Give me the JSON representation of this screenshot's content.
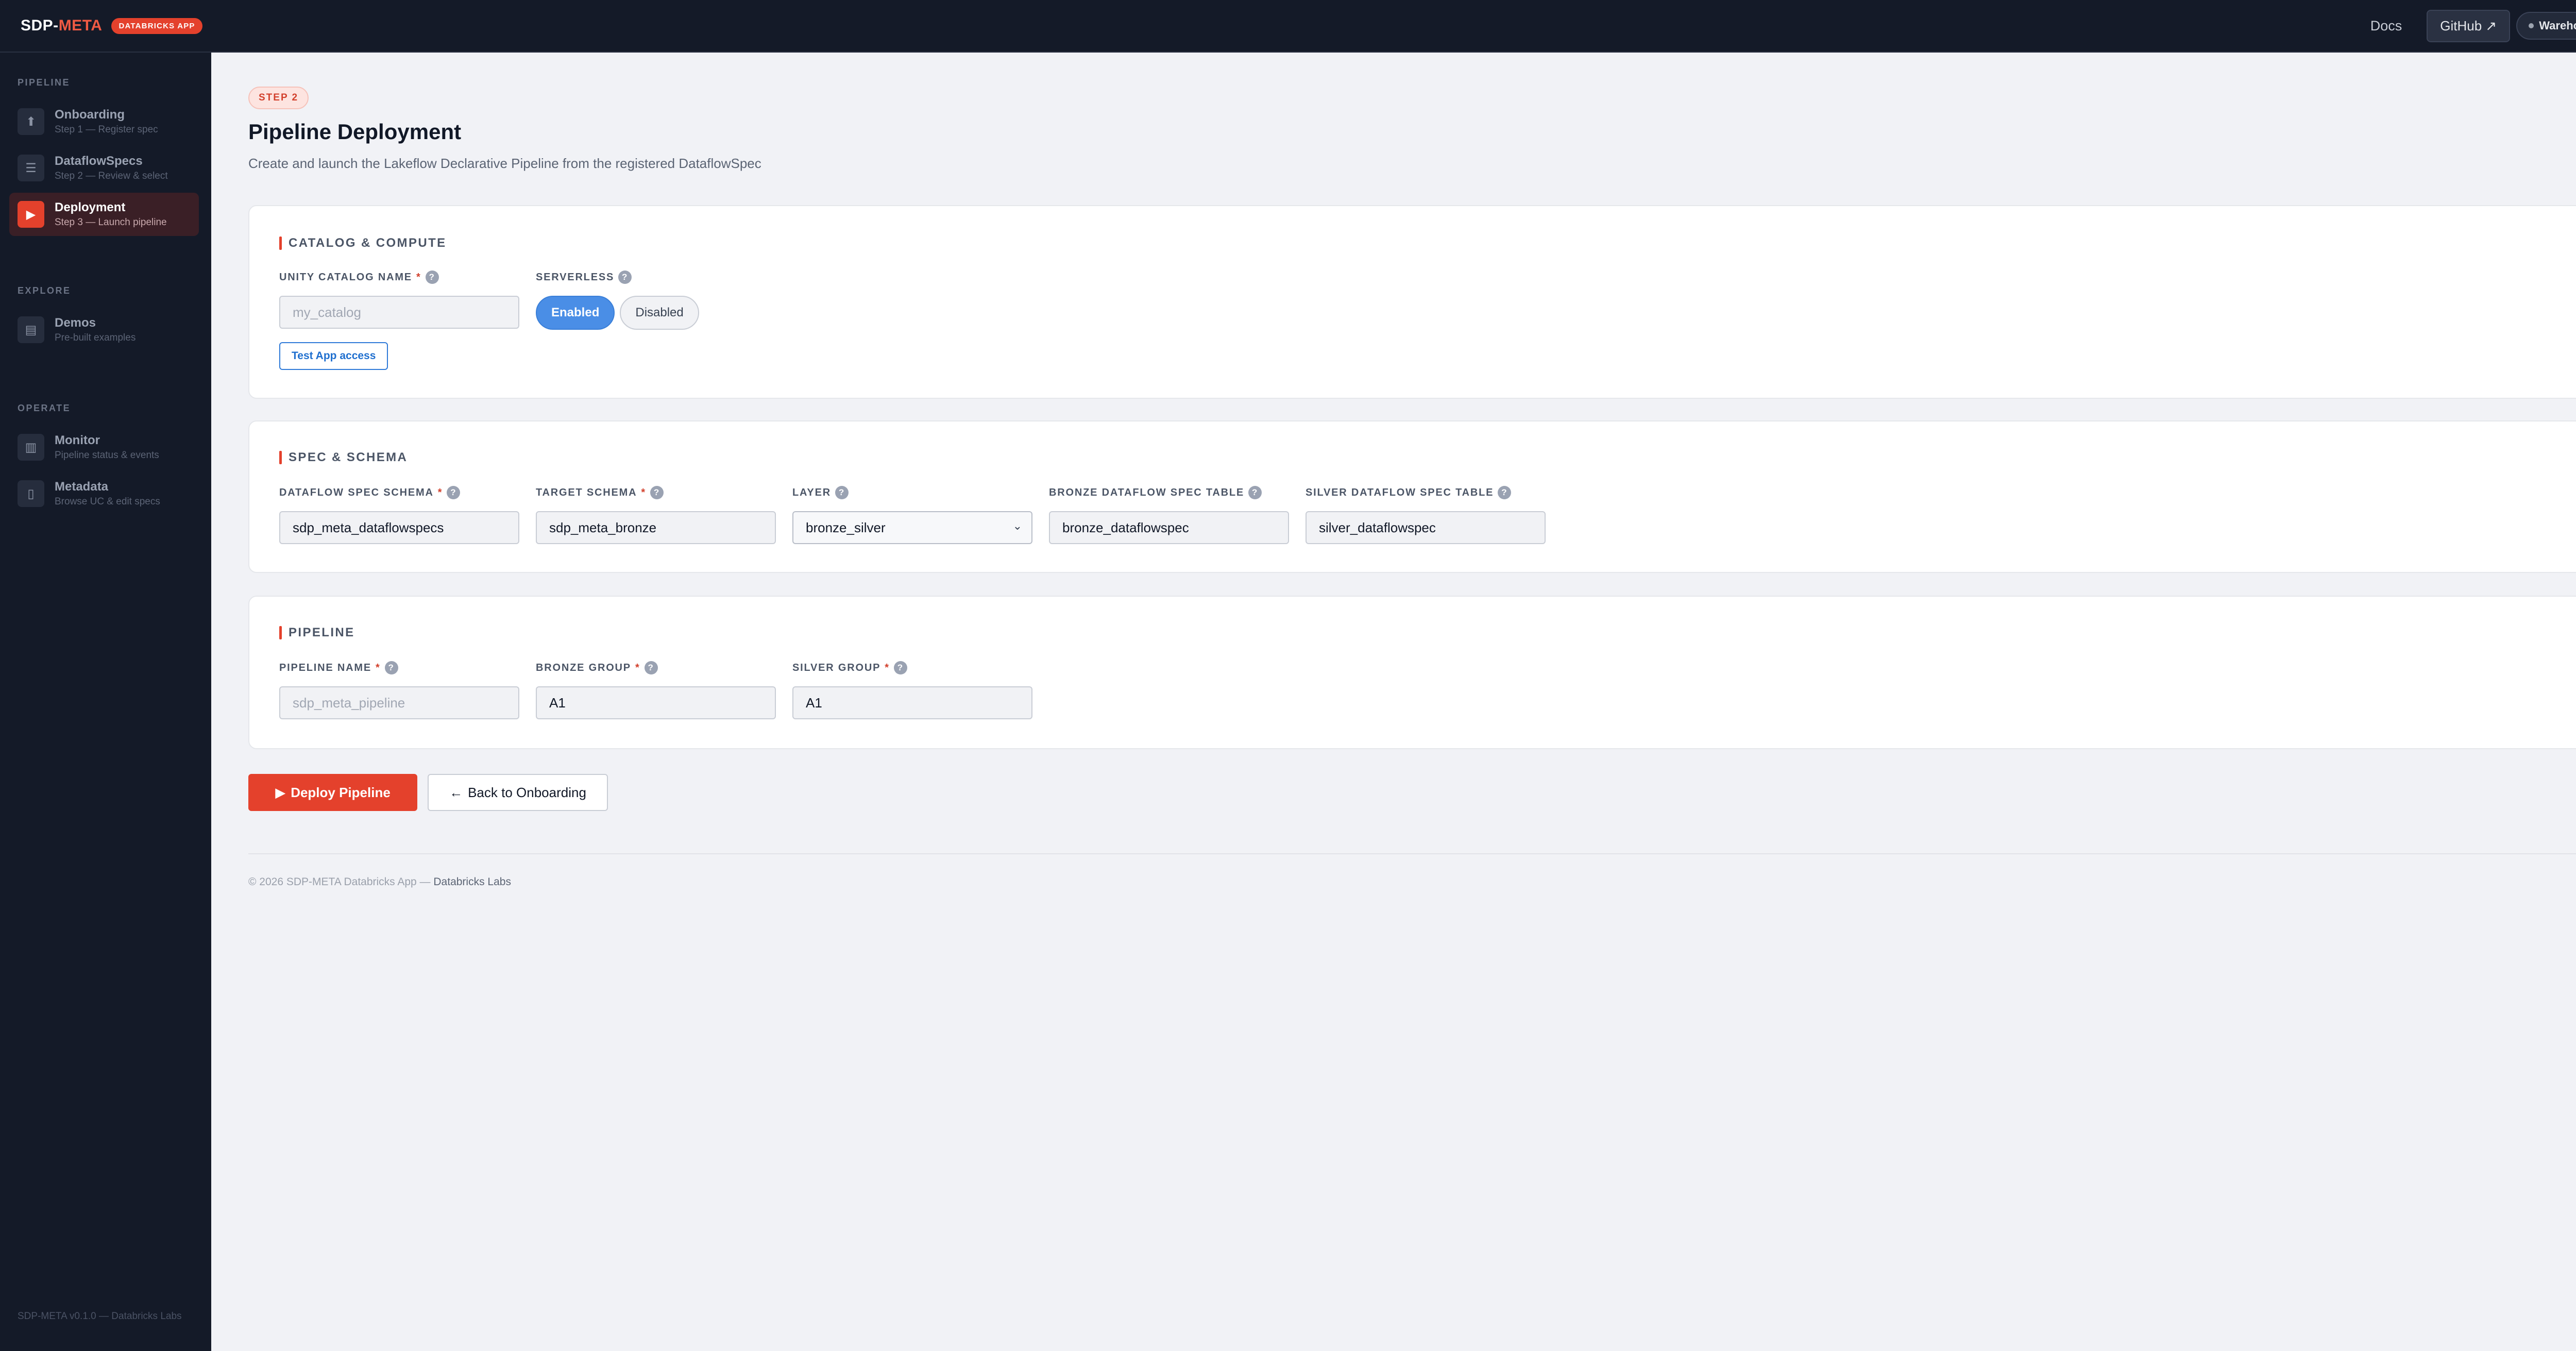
{
  "topbar": {
    "brand_prefix": "SDP-",
    "brand_accent": "META",
    "badge": "DATABRICKS APP",
    "docs": "Docs",
    "github": "GitHub ↗",
    "warehouse": "Warehouse"
  },
  "sidebar": {
    "sections": [
      {
        "label": "PIPELINE",
        "items": [
          {
            "title": "Onboarding",
            "sub": "Step 1 — Register spec",
            "icon": "upload-icon",
            "glyph": "⬆",
            "active": false
          },
          {
            "title": "DataflowSpecs",
            "sub": "Step 2 — Review & select",
            "icon": "list-icon",
            "glyph": "☰",
            "active": false
          },
          {
            "title": "Deployment",
            "sub": "Step 3 — Launch pipeline",
            "icon": "play-icon",
            "glyph": "▶",
            "active": true
          }
        ]
      },
      {
        "label": "EXPLORE",
        "items": [
          {
            "title": "Demos",
            "sub": "Pre-built examples",
            "icon": "demo-icon",
            "glyph": "▤",
            "active": false
          }
        ]
      },
      {
        "label": "OPERATE",
        "items": [
          {
            "title": "Monitor",
            "sub": "Pipeline status & events",
            "icon": "chart-icon",
            "glyph": "▥",
            "active": false
          },
          {
            "title": "Metadata",
            "sub": "Browse UC & edit specs",
            "icon": "document-icon",
            "glyph": "▯",
            "active": false
          }
        ]
      }
    ],
    "footer": "SDP-META v0.1.0 — Databricks Labs"
  },
  "main": {
    "step_badge": "STEP 2",
    "title": "Pipeline Deployment",
    "subtitle": "Create and launch the Lakeflow Declarative Pipeline from the registered DataflowSpec",
    "catalog": {
      "title": "CATALOG & COMPUTE",
      "uc_label": "UNITY CATALOG NAME",
      "uc_placeholder": "my_catalog",
      "serverless_label": "SERVERLESS",
      "enabled": "Enabled",
      "disabled": "Disabled",
      "test_button": "Test App access"
    },
    "spec": {
      "title": "SPEC & SCHEMA",
      "fields": [
        {
          "label": "DATAFLOW SPEC SCHEMA",
          "required": true,
          "value": "sdp_meta_dataflowspecs",
          "type": "input"
        },
        {
          "label": "TARGET SCHEMA",
          "required": true,
          "value": "sdp_meta_bronze",
          "type": "input"
        },
        {
          "label": "LAYER",
          "required": false,
          "value": "bronze_silver",
          "type": "select"
        },
        {
          "label": "BRONZE DATAFLOW SPEC TABLE",
          "required": false,
          "value": "bronze_dataflowspec",
          "type": "input"
        },
        {
          "label": "SILVER DATAFLOW SPEC TABLE",
          "required": false,
          "value": "silver_dataflowspec",
          "type": "input"
        }
      ]
    },
    "pipeline": {
      "title": "PIPELINE",
      "fields": [
        {
          "label": "PIPELINE NAME",
          "required": true,
          "value": "",
          "placeholder": "sdp_meta_pipeline"
        },
        {
          "label": "BRONZE GROUP",
          "required": true,
          "value": "A1",
          "placeholder": ""
        },
        {
          "label": "SILVER GROUP",
          "required": true,
          "value": "A1",
          "placeholder": ""
        }
      ]
    },
    "deploy_button": "Deploy Pipeline",
    "back_button": "Back to Onboarding",
    "footer_prefix": "© 2026 SDP-META Databricks App — ",
    "footer_org": "Databricks Labs"
  },
  "colors": {
    "accent": "#e4412c",
    "primary_blue": "#4a8ee6",
    "sidebar_bg": "#141a28",
    "page_bg": "#f1f2f6"
  }
}
